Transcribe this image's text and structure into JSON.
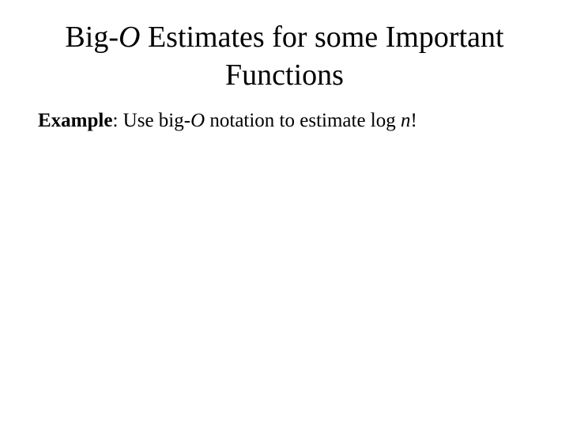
{
  "title": {
    "part1": "Big-",
    "part2_italic": "O",
    "part3": " Estimates for some Important Functions"
  },
  "body": {
    "example_label": "Example",
    "colon_space": ": ",
    "text1": "Use big-",
    "O_italic": "O",
    "text2": " notation to estimate log ",
    "n_italic": "n",
    "bang": "!"
  }
}
